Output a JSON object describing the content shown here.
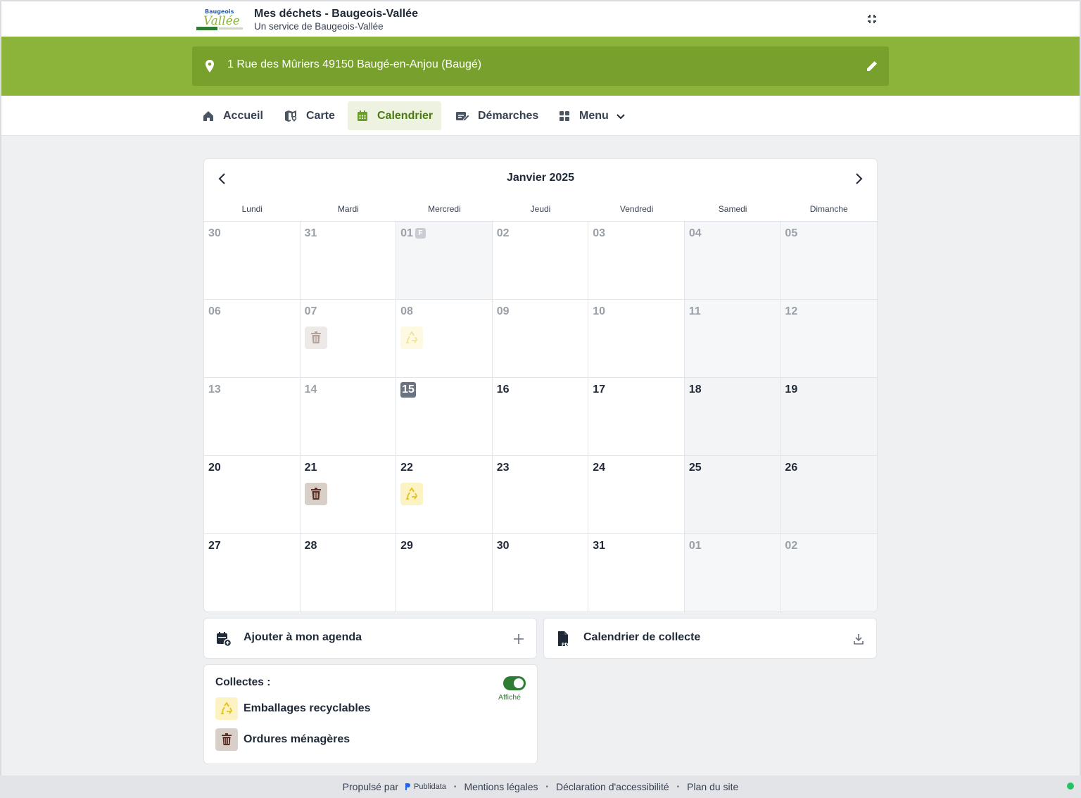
{
  "header": {
    "title": "Mes déchets - Baugeois-Vallée",
    "subtitle": "Un service de Baugeois-Vallée",
    "logo_text": "Baugeois Vallée"
  },
  "address": "1 Rue des Mûriers 49150 Baugé-en-Anjou (Baugé)",
  "nav": {
    "accueil": "Accueil",
    "carte": "Carte",
    "calendrier": "Calendrier",
    "demarches": "Démarches",
    "menu": "Menu"
  },
  "calendar": {
    "month": "Janvier 2025",
    "weekdays": [
      "Lundi",
      "Mardi",
      "Mercredi",
      "Jeudi",
      "Vendredi",
      "Samedi",
      "Dimanche"
    ],
    "holiday_badge": "F",
    "days": [
      {
        "n": "30",
        "s": "other"
      },
      {
        "n": "31",
        "s": "other"
      },
      {
        "n": "01",
        "s": "past",
        "holiday": true
      },
      {
        "n": "02",
        "s": "past"
      },
      {
        "n": "03",
        "s": "past"
      },
      {
        "n": "04",
        "s": "past",
        "we": true
      },
      {
        "n": "05",
        "s": "past",
        "we": true
      },
      {
        "n": "06",
        "s": "past"
      },
      {
        "n": "07",
        "s": "past",
        "evt": "om"
      },
      {
        "n": "08",
        "s": "past",
        "evt": "rec"
      },
      {
        "n": "09",
        "s": "past"
      },
      {
        "n": "10",
        "s": "past"
      },
      {
        "n": "11",
        "s": "past",
        "we": true
      },
      {
        "n": "12",
        "s": "past",
        "we": true
      },
      {
        "n": "13",
        "s": "past"
      },
      {
        "n": "14",
        "s": "past"
      },
      {
        "n": "15",
        "s": "today"
      },
      {
        "n": "16",
        "s": ""
      },
      {
        "n": "17",
        "s": ""
      },
      {
        "n": "18",
        "s": "",
        "we": true
      },
      {
        "n": "19",
        "s": "",
        "we": true
      },
      {
        "n": "20",
        "s": ""
      },
      {
        "n": "21",
        "s": "",
        "evt": "om"
      },
      {
        "n": "22",
        "s": "",
        "evt": "rec"
      },
      {
        "n": "23",
        "s": ""
      },
      {
        "n": "24",
        "s": ""
      },
      {
        "n": "25",
        "s": "",
        "we": true
      },
      {
        "n": "26",
        "s": "",
        "we": true
      },
      {
        "n": "27",
        "s": ""
      },
      {
        "n": "28",
        "s": ""
      },
      {
        "n": "29",
        "s": ""
      },
      {
        "n": "30",
        "s": ""
      },
      {
        "n": "31",
        "s": ""
      },
      {
        "n": "01",
        "s": "other",
        "we": true
      },
      {
        "n": "02",
        "s": "other",
        "we": true
      }
    ]
  },
  "actions": {
    "agenda": "Ajouter à mon agenda",
    "pdf": "Calendrier de collecte"
  },
  "legend": {
    "title": "Collectes :",
    "toggle_label": "Affiché",
    "recyclables": "Emballages recyclables",
    "ordures": "Ordures ménagères"
  },
  "colors": {
    "brand_green": "#8db43a",
    "ordures": "#d8cfc9",
    "recyclables": "#fdf3c2",
    "toggle_on": "#2e7d32"
  },
  "footer": {
    "powered_by": "Propulsé par",
    "publidata": "Publidata",
    "mentions": "Mentions légales",
    "accessibilite": "Déclaration d'accessibilité",
    "plan": "Plan du site"
  }
}
